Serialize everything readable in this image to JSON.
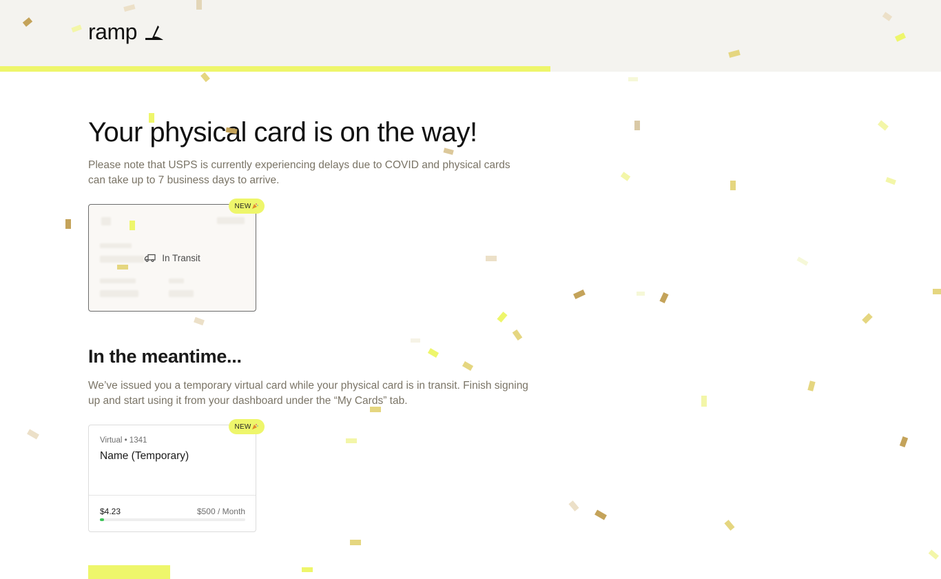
{
  "brand": {
    "name": "ramp",
    "accent_color": "#eef66b"
  },
  "progress": {
    "fraction": 0.585
  },
  "main": {
    "title": "Your physical card is on the way!",
    "subtitle": "Please note that USPS is currently experiencing delays due to COVID and physical cards can take up to 7 business days to arrive."
  },
  "physical_card": {
    "badge": "NEW",
    "badge_icon": "party-popper-icon",
    "status": "In Transit",
    "status_icon": "truck-icon"
  },
  "meantime": {
    "heading": "In the meantime...",
    "body": "We’ve issued you a temporary virtual card while your physical card is in transit. Finish signing up and start using it from your dashboard under the “My Cards” tab."
  },
  "virtual_card": {
    "badge": "NEW",
    "badge_icon": "party-popper-icon",
    "meta": "Virtual • 1341",
    "name": "Name (Temporary)",
    "spent": "$4.23",
    "limit": "$500 / Month",
    "spent_fraction": 0.0085,
    "bar_color": "#3fc45a"
  }
}
